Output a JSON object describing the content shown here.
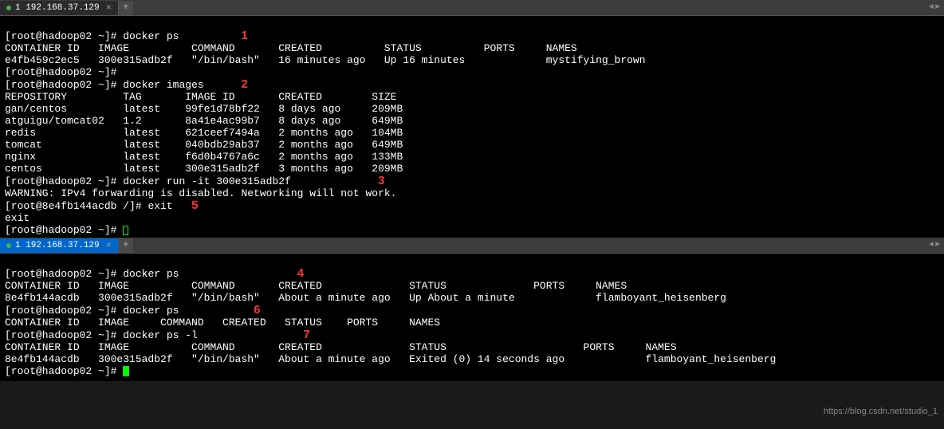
{
  "tab1": {
    "title": "1 192.168.37.129"
  },
  "tab2": {
    "title": "1 192.168.37.129"
  },
  "terminal1": {
    "prompt": "[root@hadoop02 ~]#",
    "cmd1": "docker ps",
    "ann1": "1",
    "ps_header": "CONTAINER ID   IMAGE          COMMAND       CREATED          STATUS          PORTS     NAMES",
    "ps_row1": "e4fb459c2ec5   300e315adb2f   \"/bin/bash\"   16 minutes ago   Up 16 minutes             mystifying_brown",
    "cmd2": "docker images",
    "ann2": "2",
    "img_header": "REPOSITORY         TAG       IMAGE ID       CREATED        SIZE",
    "img_r1": "gan/centos         latest    99fe1d78bf22   8 days ago     209MB",
    "img_r2": "atguigu/tomcat02   1.2       8a41e4ac99b7   8 days ago     649MB",
    "img_r3": "redis              latest    621ceef7494a   2 months ago   104MB",
    "img_r4": "tomcat             latest    040bdb29ab37   2 months ago   649MB",
    "img_r5": "nginx              latest    f6d0b4767a6c   2 months ago   133MB",
    "img_r6": "centos             latest    300e315adb2f   3 months ago   209MB",
    "cmd3": "docker run -it 300e315adb2f",
    "ann3": "3",
    "warning": "WARNING: IPv4 forwarding is disabled. Networking will not work.",
    "inner_prompt": "[root@8e4fb144acdb /]#",
    "cmd_exit": "exit",
    "ann5": "5",
    "exit_echo": "exit"
  },
  "terminal2": {
    "prompt": "[root@hadoop02 ~]#",
    "cmd1": "docker ps",
    "ann4": "4",
    "hdr1": "CONTAINER ID   IMAGE          COMMAND       CREATED              STATUS              PORTS     NAMES",
    "row1": "8e4fb144acdb   300e315adb2f   \"/bin/bash\"   About a minute ago   Up About a minute             flamboyant_heisenberg",
    "cmd2": "docker ps",
    "ann6": "6",
    "hdr2": "CONTAINER ID   IMAGE     COMMAND   CREATED   STATUS    PORTS     NAMES",
    "cmd3": "docker ps -l",
    "ann7": "7",
    "hdr3": "CONTAINER ID   IMAGE          COMMAND       CREATED              STATUS                      PORTS     NAMES",
    "row3": "8e4fb144acdb   300e315adb2f   \"/bin/bash\"   About a minute ago   Exited (0) 14 seconds ago             flamboyant_heisenberg"
  },
  "watermark": "https://blog.csdn.net/studio_1"
}
